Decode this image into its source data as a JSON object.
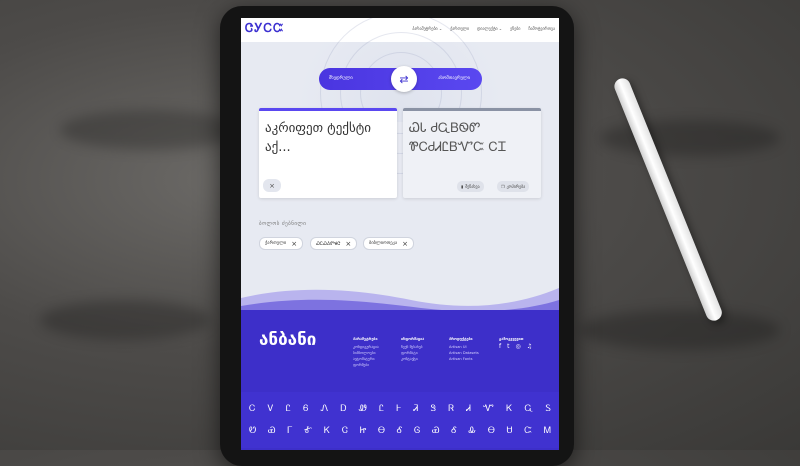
{
  "app": {
    "logo": "ᏣᎩᏟᏨ",
    "brand_footer": "ანბანი"
  },
  "nav": {
    "items": [
      "პარამეტრები ⌄",
      "ქართული",
      "დიალექტი ⌄",
      "ენები",
      "ჩამოტვირთვა"
    ]
  },
  "translator": {
    "toggle_left": "მხედრული",
    "toggle_right": "ასომთავრული",
    "swap_icon": "⇄",
    "input_placeholder": "აკრიფეთ ტექსტი აქ...",
    "output_text": "ᏇᏓ ᏧᏩᏴᏫᏛ ᏈᏟᏧᏗᏝᏴᏉᏨ ᏟᏆ",
    "clear_icon": "⨯",
    "copy_label": "კოპირება",
    "save_label": "შენახვა"
  },
  "recent": {
    "title": "ბოლოს ძებნილი",
    "chips": [
      "ქართული",
      "ᏇᏟᏇᏱᏛᏠᏣ",
      "ბიბლიოთეკა"
    ]
  },
  "footer": {
    "columns": [
      {
        "heading": "პარამეტრები",
        "items": [
          "კონფიგურაცია",
          "სიმბოლოები",
          "ავტომატური",
          "ფორმები"
        ]
      },
      {
        "heading": "ინფორმაცია",
        "items": [
          "ჩვენ შესახებ",
          "ფორმატი",
          "კონტაქტი"
        ]
      },
      {
        "heading": "პროდუქტები",
        "items": [
          "Artisan UI",
          "Artisan Datasets",
          "Artisan Fonts"
        ]
      },
      {
        "heading": "გამოგვყევით",
        "items": []
      }
    ],
    "social": [
      "f",
      "t",
      "◎",
      "♫"
    ],
    "glyph_row1": [
      "Ꮯ",
      "Ꮩ",
      "Ꮭ",
      "Ꮾ",
      "Ꮑ",
      "Ꭰ",
      "Ꮺ",
      "Ꮭ",
      "Ꮀ",
      "Ꮨ",
      "Ꮥ",
      "Ꮢ",
      "Ꮧ",
      "Ꮙ",
      "Ꮶ",
      "Ꮹ",
      "Ꮪ"
    ],
    "glyph_row2": [
      "Ꮼ",
      "Ꮿ",
      "Ꮁ",
      "Ꮉ",
      "Ꮶ",
      "Ꮳ",
      "Ꮵ",
      "Ꮎ",
      "Ꮄ",
      "Ꮆ",
      "Ꮿ",
      "Ꮄ",
      "Ꮂ",
      "Ꮎ",
      "Ꮜ",
      "Ꮸ",
      "Ꮇ"
    ]
  },
  "colors": {
    "accent": "#4a35e0",
    "footer": "#3d2fc9",
    "panel_muted": "#eff1f6"
  }
}
